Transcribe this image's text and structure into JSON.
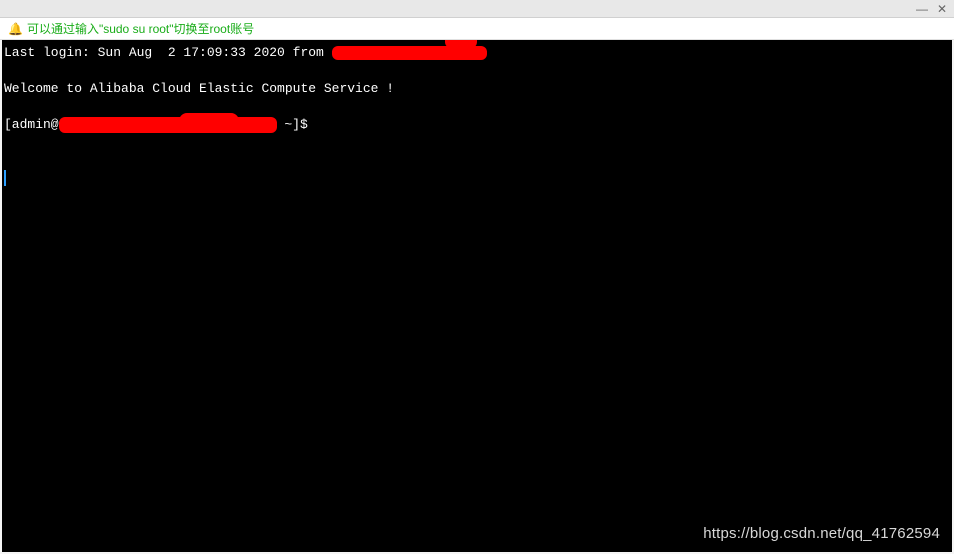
{
  "hint": {
    "icon": "🔔",
    "text": "可以通过输入\"sudo su root\"切换至root账号"
  },
  "terminal": {
    "last_login_prefix": "Last login: Sun Aug  2 17:09:33 2020 from ",
    "welcome": "Welcome to Alibaba Cloud Elastic Compute Service !",
    "prompt_prefix": "[admin@",
    "prompt_suffix": " ~]$ "
  },
  "watermark": "https://blog.csdn.net/qq_41762594"
}
